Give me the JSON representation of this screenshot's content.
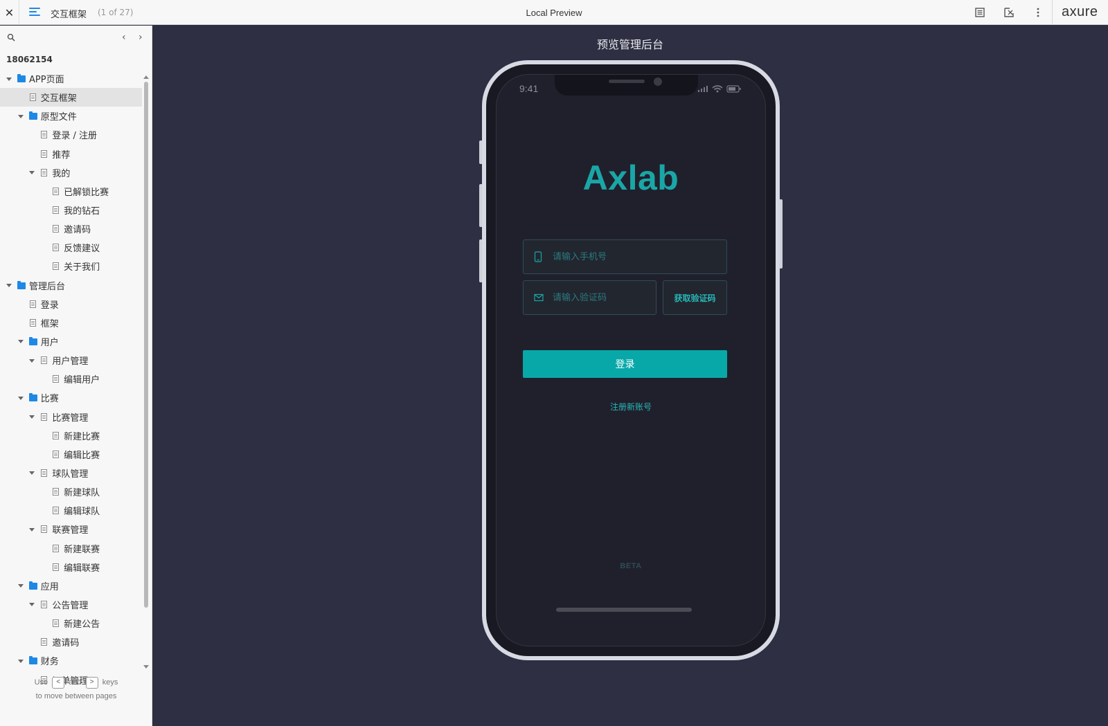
{
  "topbar": {
    "close_icon": "close-icon",
    "page_title": "交互框架",
    "page_count": "(1 of 27)",
    "preview_label": "Local Preview",
    "logo": "axure",
    "icons": [
      "notes-icon",
      "exit-fullscreen-icon",
      "more-vertical-icon"
    ]
  },
  "sidebar": {
    "project_id": "18062154",
    "tree": [
      {
        "label": "APP页面",
        "type": "folder",
        "level": 0,
        "expanded": true
      },
      {
        "label": "交互框架",
        "type": "page",
        "level": 1,
        "active": true
      },
      {
        "label": "原型文件",
        "type": "folder",
        "level": 1,
        "expanded": true
      },
      {
        "label": "登录 / 注册",
        "type": "page",
        "level": 2
      },
      {
        "label": "推荐",
        "type": "page",
        "level": 2
      },
      {
        "label": "我的",
        "type": "page",
        "level": 2,
        "expanded": true
      },
      {
        "label": "已解锁比赛",
        "type": "page",
        "level": 3
      },
      {
        "label": "我的钻石",
        "type": "page",
        "level": 3
      },
      {
        "label": "邀请码",
        "type": "page",
        "level": 3
      },
      {
        "label": "反馈建议",
        "type": "page",
        "level": 3
      },
      {
        "label": "关于我们",
        "type": "page",
        "level": 3
      },
      {
        "label": "管理后台",
        "type": "folder",
        "level": 0,
        "expanded": true
      },
      {
        "label": "登录",
        "type": "page",
        "level": 1
      },
      {
        "label": "框架",
        "type": "page",
        "level": 1
      },
      {
        "label": "用户",
        "type": "folder",
        "level": 1,
        "expanded": true
      },
      {
        "label": "用户管理",
        "type": "page",
        "level": 2,
        "expanded": true
      },
      {
        "label": "编辑用户",
        "type": "page",
        "level": 3
      },
      {
        "label": "比赛",
        "type": "folder",
        "level": 1,
        "expanded": true
      },
      {
        "label": "比赛管理",
        "type": "page",
        "level": 2,
        "expanded": true
      },
      {
        "label": "新建比赛",
        "type": "page",
        "level": 3
      },
      {
        "label": "编辑比赛",
        "type": "page",
        "level": 3
      },
      {
        "label": "球队管理",
        "type": "page",
        "level": 2,
        "expanded": true
      },
      {
        "label": "新建球队",
        "type": "page",
        "level": 3
      },
      {
        "label": "编辑球队",
        "type": "page",
        "level": 3
      },
      {
        "label": "联赛管理",
        "type": "page",
        "level": 2,
        "expanded": true
      },
      {
        "label": "新建联赛",
        "type": "page",
        "level": 3
      },
      {
        "label": "编辑联赛",
        "type": "page",
        "level": 3
      },
      {
        "label": "应用",
        "type": "folder",
        "level": 1,
        "expanded": true
      },
      {
        "label": "公告管理",
        "type": "page",
        "level": 2,
        "expanded": true
      },
      {
        "label": "新建公告",
        "type": "page",
        "level": 3
      },
      {
        "label": "邀请码",
        "type": "page",
        "level": 2
      },
      {
        "label": "财务",
        "type": "folder",
        "level": 1,
        "expanded": true
      },
      {
        "label": "订单管理",
        "type": "page",
        "level": 2
      }
    ],
    "hint": {
      "use": "Use",
      "and": "and",
      "keys": "keys",
      "line2": "to move between pages",
      "prev_key": "<",
      "next_key": ">"
    }
  },
  "preview": {
    "title": "预览管理后台",
    "phone": {
      "time": "9:41",
      "brand": "Axlab",
      "phone_input_placeholder": "请输入手机号",
      "code_input_placeholder": "请输入验证码",
      "get_code_label": "获取验证码",
      "login_label": "登录",
      "register_label": "注册新账号",
      "beta_label": "BETA"
    }
  },
  "colors": {
    "accent": "#08a8a8",
    "preview_bg": "#2e2f42",
    "phone_screen": "#20202c",
    "sidebar_bg": "#f7f7f7",
    "folder_blue": "#1e88e5"
  }
}
